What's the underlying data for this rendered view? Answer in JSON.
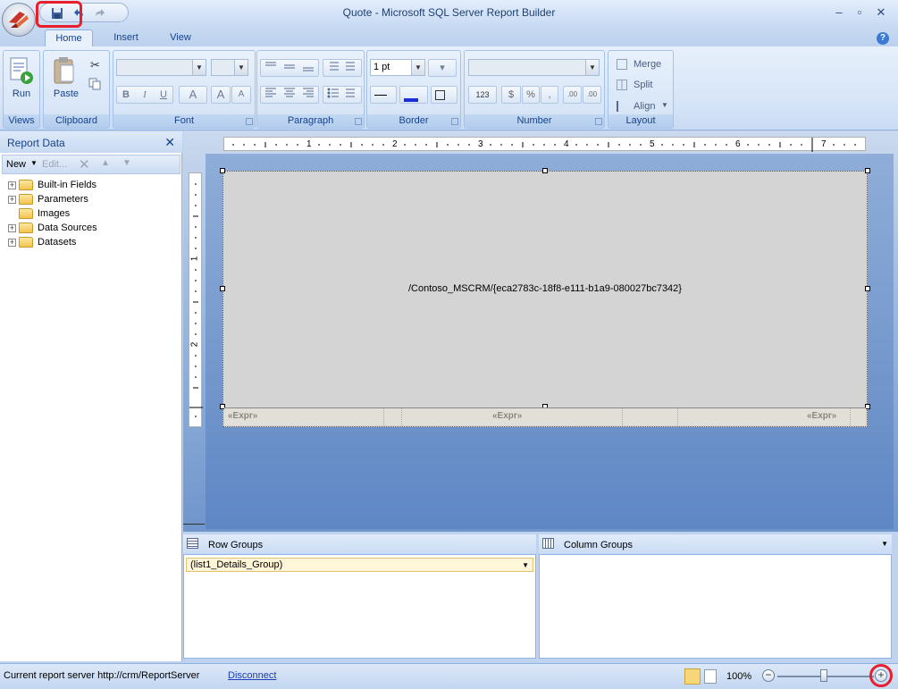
{
  "window": {
    "title": "Quote - Microsoft SQL Server Report Builder"
  },
  "tabs": [
    "Home",
    "Insert",
    "View"
  ],
  "ribbon": {
    "views": {
      "run_label": "Run",
      "group": "Views"
    },
    "clipboard": {
      "paste_label": "Paste",
      "group": "Clipboard"
    },
    "font": {
      "group": "Font",
      "bold": "B",
      "italic": "I",
      "underline": "U",
      "font_color": "A",
      "grow": "A",
      "shrink": "A"
    },
    "paragraph": {
      "group": "Paragraph"
    },
    "border": {
      "group": "Border",
      "width_value": "1 pt"
    },
    "number": {
      "group": "Number",
      "placeholders": "123",
      "currency": "$",
      "percent": "%",
      "comma": ",",
      "inc_decimal": ".00",
      "dec_decimal": ".00"
    },
    "layout": {
      "group": "Layout",
      "merge": "Merge",
      "split": "Split",
      "align": "Align"
    }
  },
  "report_data": {
    "title": "Report Data",
    "toolbar": {
      "new": "New",
      "edit": "Edit..."
    },
    "tree": [
      {
        "label": "Built-in Fields",
        "expandable": true
      },
      {
        "label": "Parameters",
        "expandable": true
      },
      {
        "label": "Images",
        "expandable": false
      },
      {
        "label": "Data Sources",
        "expandable": true
      },
      {
        "label": "Datasets",
        "expandable": true
      }
    ]
  },
  "rulers": {
    "horizontal": [
      "1",
      "2",
      "3",
      "4",
      "5",
      "6",
      "7"
    ],
    "vertical": [
      "1",
      "2"
    ]
  },
  "design": {
    "body_text": "/Contoso_MSCRM/{eca2783c-18f8-e111-b1a9-080027bc7342}",
    "footer": [
      "«Expr»",
      "«Expr»",
      "«Expr»"
    ]
  },
  "groups": {
    "row_title": "Row Groups",
    "column_title": "Column Groups",
    "row_items": [
      "(list1_Details_Group)"
    ]
  },
  "status": {
    "server_text": "Current report server http://crm/ReportServer",
    "disconnect": "Disconnect",
    "zoom": "100%",
    "zoom_minus": "−",
    "zoom_plus": "+"
  },
  "colors": {
    "highlight": "#e8202e",
    "ribbon_text": "#15428b"
  }
}
